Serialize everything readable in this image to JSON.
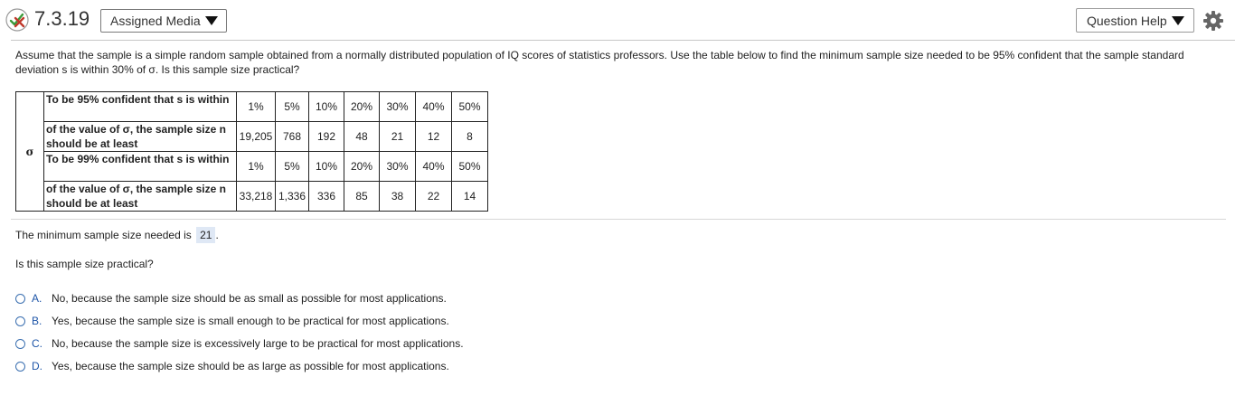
{
  "header": {
    "question_number": "7.3.19",
    "media_button_label": "Assigned Media",
    "help_button_label": "Question Help"
  },
  "question": {
    "text": "Assume that the sample is a simple random sample obtained from a normally distributed population of IQ scores of statistics professors. Use the table below to find the minimum sample size needed to be 95% confident that the sample standard deviation s is within 30% of σ. Is this sample size practical?"
  },
  "table": {
    "sigma_label": "σ",
    "rows": [
      {
        "label": "To be 95% confident that s is within",
        "cells": [
          "1%",
          "5%",
          "10%",
          "20%",
          "30%",
          "40%",
          "50%"
        ]
      },
      {
        "label": "of the value of σ, the sample size n should be at least",
        "cells": [
          "19,205",
          "768",
          "192",
          "48",
          "21",
          "12",
          "8"
        ]
      },
      {
        "label": "To be 99% confident that s is within",
        "cells": [
          "1%",
          "5%",
          "10%",
          "20%",
          "30%",
          "40%",
          "50%"
        ]
      },
      {
        "label": "of the value of σ, the sample size n should be at least",
        "cells": [
          "33,218",
          "1,336",
          "336",
          "85",
          "38",
          "22",
          "14"
        ]
      }
    ]
  },
  "answer": {
    "prefix": "The minimum sample size needed is",
    "value": "21",
    "suffix": "."
  },
  "practical_question": "Is this sample size practical?",
  "options": [
    {
      "letter": "A.",
      "text": "No, because the sample size should be as small as possible for most applications."
    },
    {
      "letter": "B.",
      "text": "Yes, because the sample size is small enough to be practical for most applications."
    },
    {
      "letter": "C.",
      "text": "No, because the sample size is excessively large to be practical for most applications."
    },
    {
      "letter": "D.",
      "text": "Yes, because the sample size should be as large as possible for most applications."
    }
  ],
  "colors": {
    "accent_blue": "#1f56a8",
    "answer_highlight": "#dfe8f5",
    "partial_correct_red": "#c0392b",
    "partial_correct_green": "#3a9a3a"
  }
}
